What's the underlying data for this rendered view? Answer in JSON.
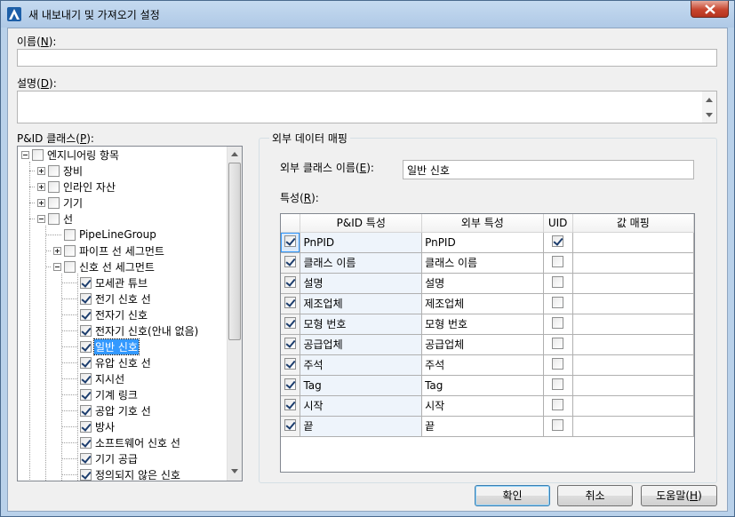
{
  "window": {
    "title": "새 내보내기 및 가져오기 설정"
  },
  "name_field": {
    "label_prefix": "이름(",
    "label_key": "N",
    "label_suffix": "):",
    "value": ""
  },
  "description_field": {
    "label_prefix": "설명(",
    "label_key": "D",
    "label_suffix": "):",
    "value": ""
  },
  "class_tree": {
    "label_prefix": "P&ID 클래스(",
    "label_key": "P",
    "label_suffix": "):",
    "items": [
      {
        "label": "엔지니어링 항목",
        "level": 0,
        "expander": "minus",
        "checked": false,
        "selected": false
      },
      {
        "label": "장비",
        "level": 1,
        "expander": "plus",
        "checked": false,
        "selected": false
      },
      {
        "label": "인라인 자산",
        "level": 1,
        "expander": "plus",
        "checked": false,
        "selected": false
      },
      {
        "label": "기기",
        "level": 1,
        "expander": "plus",
        "checked": false,
        "selected": false
      },
      {
        "label": "선",
        "level": 1,
        "expander": "minus",
        "checked": false,
        "selected": false
      },
      {
        "label": "PipeLineGroup",
        "level": 2,
        "expander": "none",
        "checked": false,
        "selected": false
      },
      {
        "label": "파이프 선 세그먼트",
        "level": 2,
        "expander": "plus",
        "checked": false,
        "selected": false
      },
      {
        "label": "신호 선 세그먼트",
        "level": 2,
        "expander": "minus",
        "checked": false,
        "selected": false
      },
      {
        "label": "모세관 튜브",
        "level": 3,
        "expander": "none",
        "checked": true,
        "selected": false
      },
      {
        "label": "전기 신호 선",
        "level": 3,
        "expander": "none",
        "checked": true,
        "selected": false
      },
      {
        "label": "전자기 신호",
        "level": 3,
        "expander": "none",
        "checked": true,
        "selected": false
      },
      {
        "label": "전자기 신호(안내 없음)",
        "level": 3,
        "expander": "none",
        "checked": true,
        "selected": false
      },
      {
        "label": "일반 신호",
        "level": 3,
        "expander": "none",
        "checked": true,
        "selected": true
      },
      {
        "label": "유압 신호 선",
        "level": 3,
        "expander": "none",
        "checked": true,
        "selected": false
      },
      {
        "label": "지시선",
        "level": 3,
        "expander": "none",
        "checked": true,
        "selected": false
      },
      {
        "label": "기계 링크",
        "level": 3,
        "expander": "none",
        "checked": true,
        "selected": false
      },
      {
        "label": "공압 기호 선",
        "level": 3,
        "expander": "none",
        "checked": true,
        "selected": false
      },
      {
        "label": "방사",
        "level": 3,
        "expander": "none",
        "checked": true,
        "selected": false
      },
      {
        "label": "소프트웨어 신호 선",
        "level": 3,
        "expander": "none",
        "checked": true,
        "selected": false
      },
      {
        "label": "기기 공급",
        "level": 3,
        "expander": "none",
        "checked": true,
        "selected": false
      },
      {
        "label": "정의되지 않은 신호",
        "level": 3,
        "expander": "none",
        "checked": true,
        "selected": false
      }
    ]
  },
  "mapping": {
    "group_title": "외부 데이터 매핑",
    "ext_class_label_prefix": "외부 클래스 이름(",
    "ext_class_label_key": "E",
    "ext_class_label_suffix": "):",
    "ext_class_value": "일반 신호",
    "props_label_prefix": "특성(",
    "props_label_key": "R",
    "props_label_suffix": "):",
    "columns": {
      "pid": "P&ID 특성",
      "ext": "외부 특성",
      "uid": "UID",
      "val": "값 매핑"
    },
    "rows": [
      {
        "checked": true,
        "pid": "PnPID",
        "ext": "PnPID",
        "uid": true,
        "val": ""
      },
      {
        "checked": true,
        "pid": "클래스 이름",
        "ext": "클래스 이름",
        "uid": false,
        "val": ""
      },
      {
        "checked": true,
        "pid": "설명",
        "ext": "설명",
        "uid": false,
        "val": ""
      },
      {
        "checked": true,
        "pid": "제조업체",
        "ext": "제조업체",
        "uid": false,
        "val": ""
      },
      {
        "checked": true,
        "pid": "모형 번호",
        "ext": "모형 번호",
        "uid": false,
        "val": ""
      },
      {
        "checked": true,
        "pid": "공급업체",
        "ext": "공급업체",
        "uid": false,
        "val": ""
      },
      {
        "checked": true,
        "pid": "주석",
        "ext": "주석",
        "uid": false,
        "val": ""
      },
      {
        "checked": true,
        "pid": "Tag",
        "ext": "Tag",
        "uid": false,
        "val": ""
      },
      {
        "checked": true,
        "pid": "시작",
        "ext": "시작",
        "uid": false,
        "val": ""
      },
      {
        "checked": true,
        "pid": "끝",
        "ext": "끝",
        "uid": false,
        "val": ""
      }
    ]
  },
  "buttons": {
    "ok": "확인",
    "cancel": "취소",
    "help_prefix": "도움말(",
    "help_key": "H",
    "help_suffix": ")"
  },
  "icons": {
    "app": "autocad-plant-triangle-icon",
    "close": "close-icon"
  }
}
